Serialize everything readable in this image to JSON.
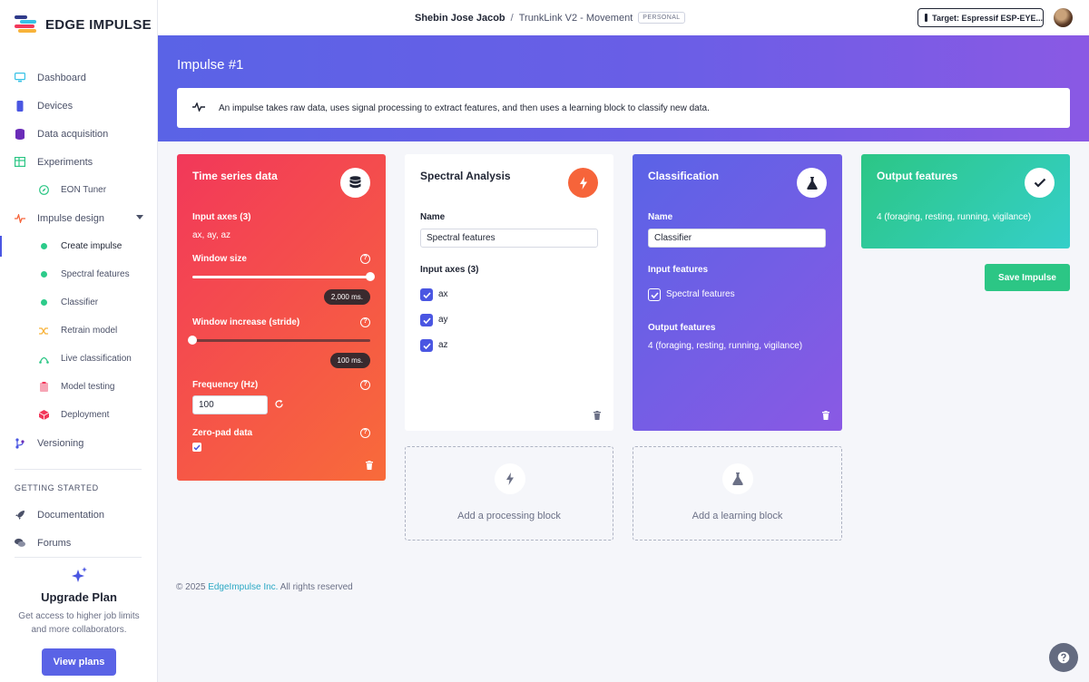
{
  "brand": {
    "name": "EDGE IMPULSE"
  },
  "sidebar": {
    "items": [
      {
        "label": "Dashboard"
      },
      {
        "label": "Devices"
      },
      {
        "label": "Data acquisition"
      },
      {
        "label": "Experiments"
      },
      {
        "label": "EON Tuner"
      },
      {
        "label": "Impulse design"
      },
      {
        "label": "Create impulse"
      },
      {
        "label": "Spectral features"
      },
      {
        "label": "Classifier"
      },
      {
        "label": "Retrain model"
      },
      {
        "label": "Live classification"
      },
      {
        "label": "Model testing"
      },
      {
        "label": "Deployment"
      },
      {
        "label": "Versioning"
      }
    ],
    "section_label": "GETTING STARTED",
    "getting_started": [
      {
        "label": "Documentation"
      },
      {
        "label": "Forums"
      }
    ],
    "upgrade": {
      "title": "Upgrade Plan",
      "description": "Get access to higher job limits and more collaborators.",
      "button_label": "View plans"
    }
  },
  "topbar": {
    "user": "Shebin Jose Jacob",
    "separator": "/",
    "project": "TrunkLink V2 - Movement",
    "badge": "PERSONAL",
    "target": "Target: Espressif ESP-EYE..."
  },
  "header": {
    "title": "Impulse #1",
    "info": "An impulse takes raw data, uses signal processing to extract features, and then uses a learning block to classify new data."
  },
  "time_series": {
    "title": "Time series data",
    "input_axes_label": "Input axes (3)",
    "input_axes_value": "ax, ay, az",
    "window_size_label": "Window size",
    "window_size_value": "2,000 ms.",
    "window_size_fraction": 1.0,
    "window_increase_label": "Window increase (stride)",
    "window_increase_value": "100 ms.",
    "window_increase_fraction": 0.0,
    "frequency_label": "Frequency (Hz)",
    "frequency_value": "100",
    "zero_pad_label": "Zero-pad data",
    "zero_pad_checked": true
  },
  "spectral": {
    "title": "Spectral Analysis",
    "name_label": "Name",
    "name_value": "Spectral features",
    "input_axes_label": "Input axes (3)",
    "axes": [
      {
        "label": "ax",
        "checked": true
      },
      {
        "label": "ay",
        "checked": true
      },
      {
        "label": "az",
        "checked": true
      }
    ]
  },
  "classification": {
    "title": "Classification",
    "name_label": "Name",
    "name_value": "Classifier",
    "input_features_label": "Input features",
    "input_feature": "Spectral features",
    "output_features_label": "Output features",
    "output_features_value": "4 (foraging, resting, running, vigilance)"
  },
  "output": {
    "title": "Output features",
    "value": "4 (foraging, resting, running, vigilance)",
    "save_label": "Save Impulse"
  },
  "add_blocks": {
    "processing": "Add a processing block",
    "learning": "Add a learning block"
  },
  "footer": {
    "copyright": "© 2025",
    "company": "EdgeImpulse Inc.",
    "rights": "All rights reserved"
  },
  "colors": {
    "primary": "#5a63e6",
    "time_series_from": "#f2385a",
    "time_series_to": "#f86b3a",
    "classification_from": "#5a63e6",
    "classification_to": "#8a59e4",
    "output_from": "#2cc685",
    "output_to": "#35cfc9",
    "spectral_accent": "#f6643a"
  }
}
